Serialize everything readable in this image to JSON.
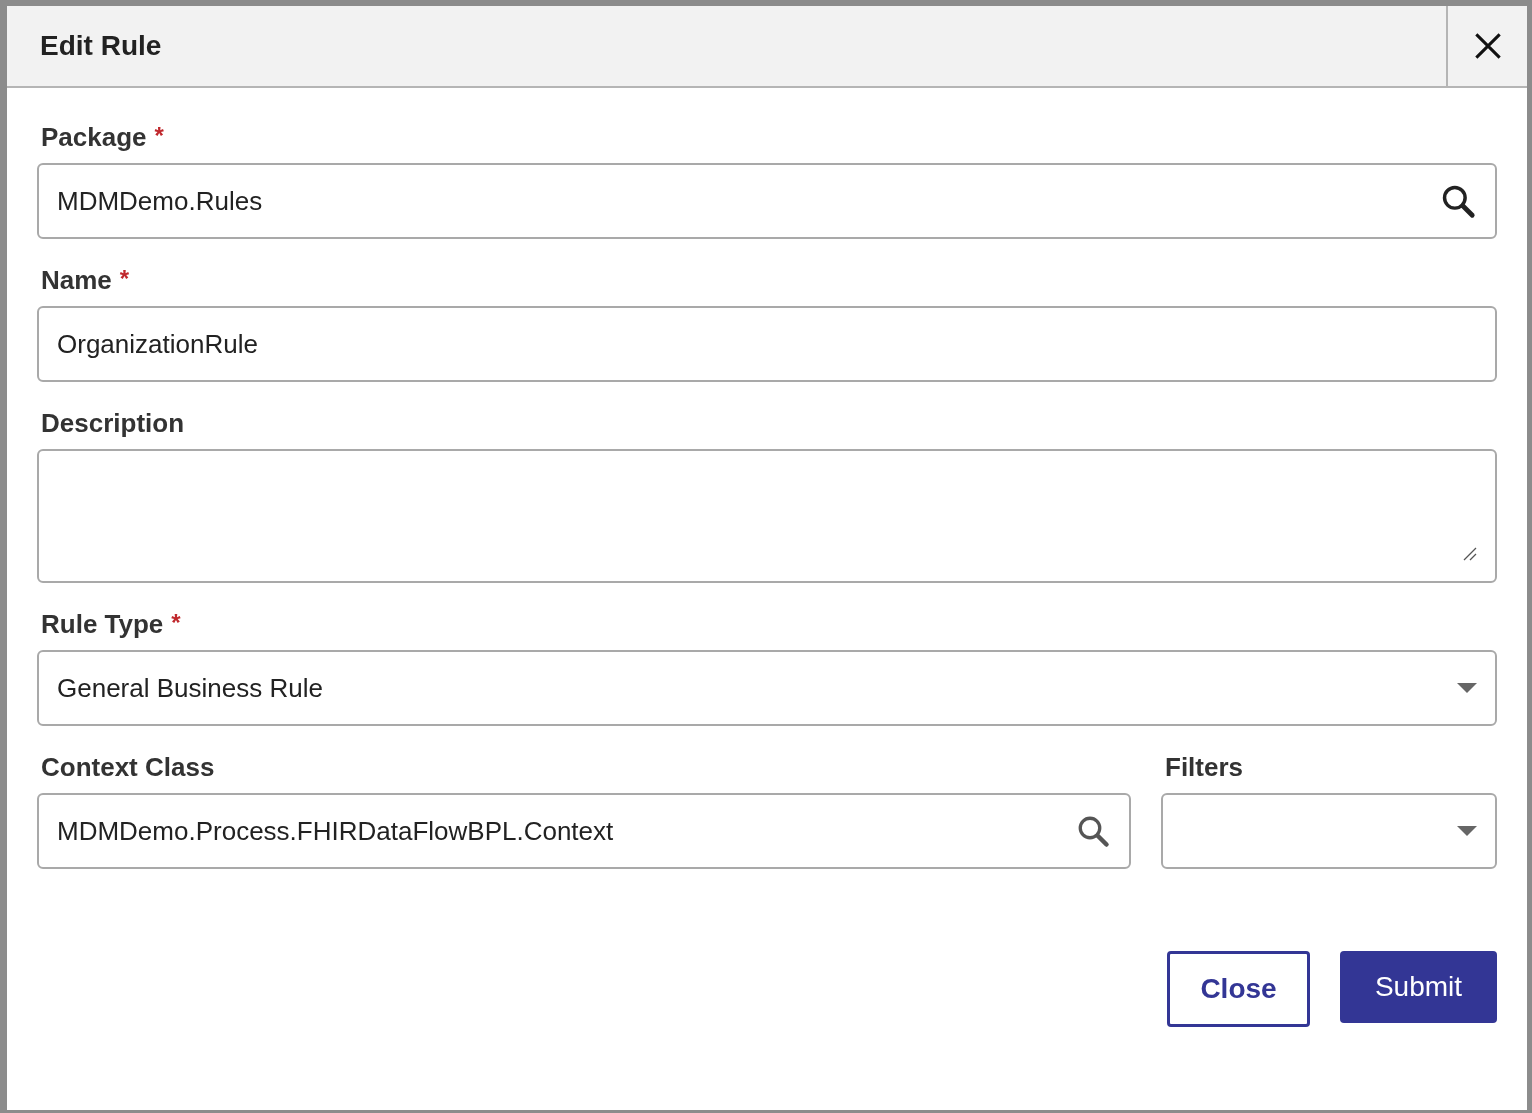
{
  "dialog": {
    "title": "Edit Rule"
  },
  "rows": [
    [
      {
        "kind": "lookup",
        "label": "Package",
        "required_mark": "*",
        "value": "MDMDemo.Rules"
      }
    ],
    [
      {
        "kind": "text",
        "label": "Name",
        "required_mark": "*",
        "value": "OrganizationRule"
      }
    ],
    [
      {
        "kind": "textarea",
        "label": "Description"
      }
    ],
    [
      {
        "kind": "select",
        "label": "Rule Type",
        "required_mark": "*",
        "value": "General Business Rule"
      }
    ],
    [
      {
        "kind": "lookup",
        "label": "Context Class",
        "value": "MDMDemo.Process.FHIRDataFlowBPL.Context"
      },
      {
        "kind": "select",
        "label": "Filters"
      }
    ]
  ],
  "buttons": [
    {
      "kind": "secondary",
      "label": "Close"
    },
    {
      "kind": "primary",
      "label": "Submit"
    }
  ]
}
